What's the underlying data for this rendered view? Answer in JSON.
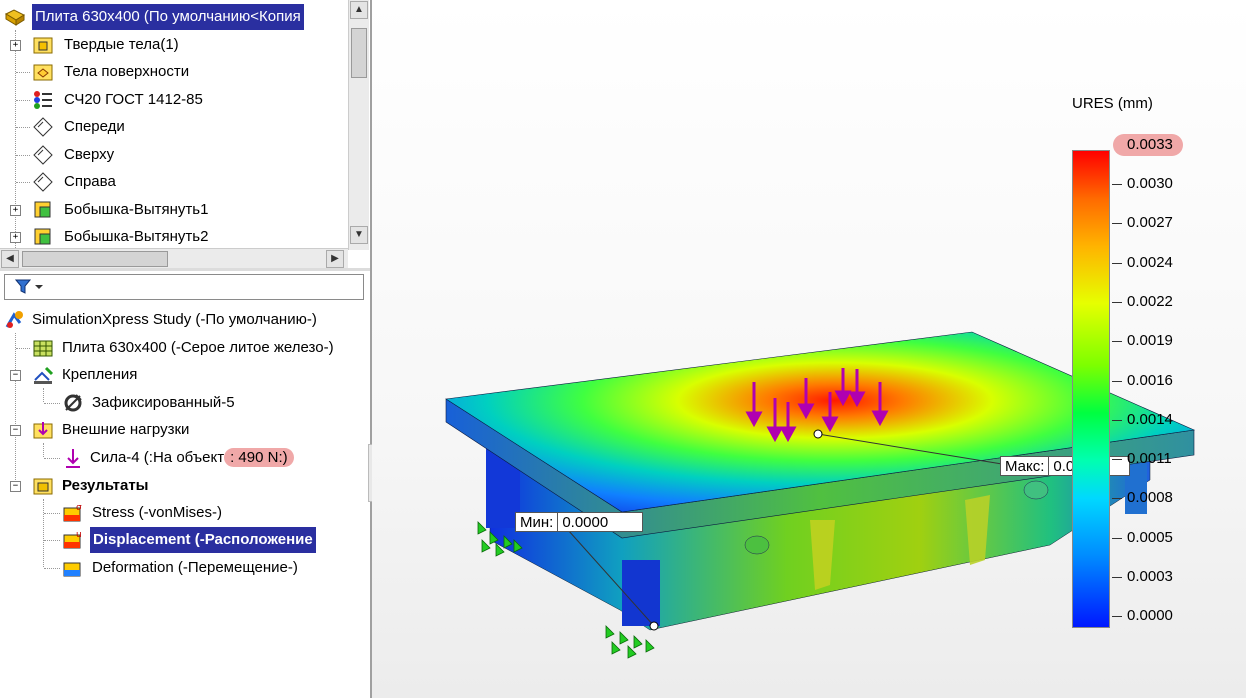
{
  "tree_top": {
    "root": "Плита 630x400  (По умолчанию<Копия",
    "items": [
      {
        "label": "Твердые тела(1)"
      },
      {
        "label": "Тела поверхности"
      },
      {
        "label": "СЧ20 ГОСТ 1412-85"
      },
      {
        "label": "Спереди"
      },
      {
        "label": "Сверху"
      },
      {
        "label": "Справа"
      },
      {
        "label": "Бобышка-Вытянуть1"
      },
      {
        "label": "Бобышка-Вытянуть2"
      }
    ]
  },
  "sim_tree": {
    "study": "SimulationXpress Study (-По умолчанию-)",
    "part": "Плита 630x400 (-Серое литое железо-)",
    "fixtures": "Крепления",
    "fixture_item": "Зафиксированный-5",
    "loads": "Внешние нагрузки",
    "force_prefix": "Сила-4 (:На объект",
    "force_value": ": 490 N:)",
    "results": "Результаты",
    "stress": "Stress (-vonMises-)",
    "displacement": "Displacement (-Расположение",
    "deformation": "Deformation (-Перемещение-)"
  },
  "legend": {
    "title": "URES (mm)",
    "max_label": "0.0033",
    "ticks": [
      "0.0030",
      "0.0027",
      "0.0024",
      "0.0022",
      "0.0019",
      "0.0016",
      "0.0014",
      "0.0011",
      "0.0008",
      "0.0005",
      "0.0003",
      "0.0000"
    ]
  },
  "probes": {
    "max_key": "Макс:",
    "max_value": "0.0033",
    "min_key": "Мин:",
    "min_value": "0.0000"
  },
  "colors": {
    "selection": "#2a2fa0",
    "highlight": "#f0a8a8",
    "load_arrow": "#b000b0",
    "fixture": "#22cc22"
  }
}
